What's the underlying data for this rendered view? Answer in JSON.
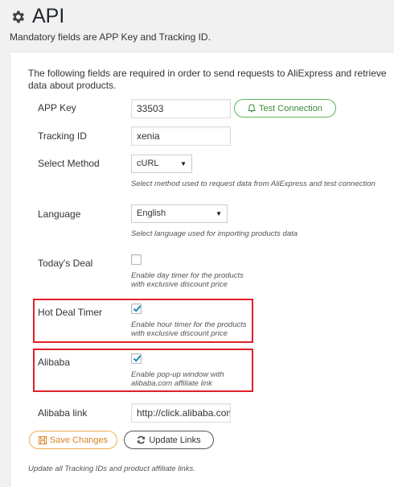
{
  "header": {
    "title": "API",
    "subtitle": "Mandatory fields are APP Key and Tracking ID."
  },
  "intro": "The following fields are required in order to send requests to AliExpress and retrieve data about products.",
  "fields": {
    "app_key": {
      "label": "APP Key",
      "value": "33503"
    },
    "tracking_id": {
      "label": "Tracking ID",
      "value": "xenia"
    },
    "select_method": {
      "label": "Select Method",
      "value": "cURL",
      "help": "Select method used to request data from AliExpress and test connection"
    },
    "language": {
      "label": "Language",
      "value": "English",
      "help": "Select language used for importing products data"
    },
    "todays_deal": {
      "label": "Today's Deal",
      "checked": false,
      "help_line1": "Enable day timer for the products",
      "help_line2": "with exclusive discount price"
    },
    "hot_deal_timer": {
      "label": "Hot Deal Timer",
      "checked": true,
      "help_line1": "Enable hour timer for the products",
      "help_line2": "with exclusive discount price"
    },
    "alibaba": {
      "label": "Alibaba",
      "checked": true,
      "help_line1": "Enable pop-up window with",
      "help_line2": "alibaba.com affiliate link"
    },
    "alibaba_link": {
      "label": "Alibaba link",
      "value": "http://click.alibaba.com/"
    }
  },
  "buttons": {
    "test_connection": "Test Connection",
    "save_changes": "Save Changes",
    "update_links": "Update Links"
  },
  "footer_note": "Update all Tracking IDs and product affiliate links.",
  "colors": {
    "highlight": "#e0202a",
    "test_button": "#5cb85c",
    "save_button": "#f0ad4e",
    "checkbox_check": "#1e8cbe"
  },
  "icons": {
    "title": "gear-icon",
    "test_connection": "bell-icon",
    "save_changes": "save-icon",
    "update_links": "refresh-icon",
    "select_arrow": "caret-down-icon"
  }
}
